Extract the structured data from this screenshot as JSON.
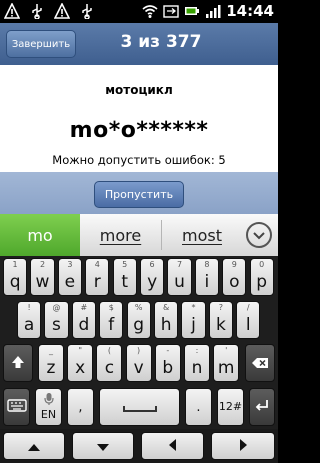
{
  "status": {
    "time": "14:44",
    "icons_left": [
      "usb-icon",
      "warning-icon",
      "usb-icon",
      "warning-icon"
    ],
    "icons_right": [
      "wifi-icon",
      "sync-icon",
      "battery-icon",
      "signal-icon"
    ]
  },
  "title": {
    "finish_label": "Завершить",
    "counter": "3 из 377"
  },
  "game": {
    "word": "мотоцикл",
    "mask": "mo*o******",
    "errors": "Можно допустить ошибок: 5"
  },
  "skip_label": "Пропустить",
  "suggestions": {
    "first": "mo",
    "second": "more",
    "third": "most"
  },
  "keyboard": {
    "row1": [
      {
        "k": "q",
        "a": "1"
      },
      {
        "k": "w",
        "a": "2"
      },
      {
        "k": "e",
        "a": "3"
      },
      {
        "k": "r",
        "a": "4"
      },
      {
        "k": "t",
        "a": "5"
      },
      {
        "k": "y",
        "a": "6"
      },
      {
        "k": "u",
        "a": "7"
      },
      {
        "k": "i",
        "a": "8"
      },
      {
        "k": "o",
        "a": "9"
      },
      {
        "k": "p",
        "a": "0"
      }
    ],
    "row2": [
      {
        "k": "a",
        "a": "!"
      },
      {
        "k": "s",
        "a": "@"
      },
      {
        "k": "d",
        "a": "#"
      },
      {
        "k": "f",
        "a": "$"
      },
      {
        "k": "g",
        "a": "%"
      },
      {
        "k": "h",
        "a": "&"
      },
      {
        "k": "j",
        "a": "*"
      },
      {
        "k": "k",
        "a": "?"
      },
      {
        "k": "l",
        "a": "/"
      }
    ],
    "row3": [
      {
        "k": "z",
        "a": "_"
      },
      {
        "k": "x",
        "a": "\""
      },
      {
        "k": "c",
        "a": "("
      },
      {
        "k": "v",
        "a": ")"
      },
      {
        "k": "b",
        "a": "-"
      },
      {
        "k": "n",
        "a": ":"
      },
      {
        "k": "m",
        "a": "'"
      }
    ],
    "lang": "EN",
    "comma": ",",
    "period": ".",
    "symbols": "12#"
  }
}
